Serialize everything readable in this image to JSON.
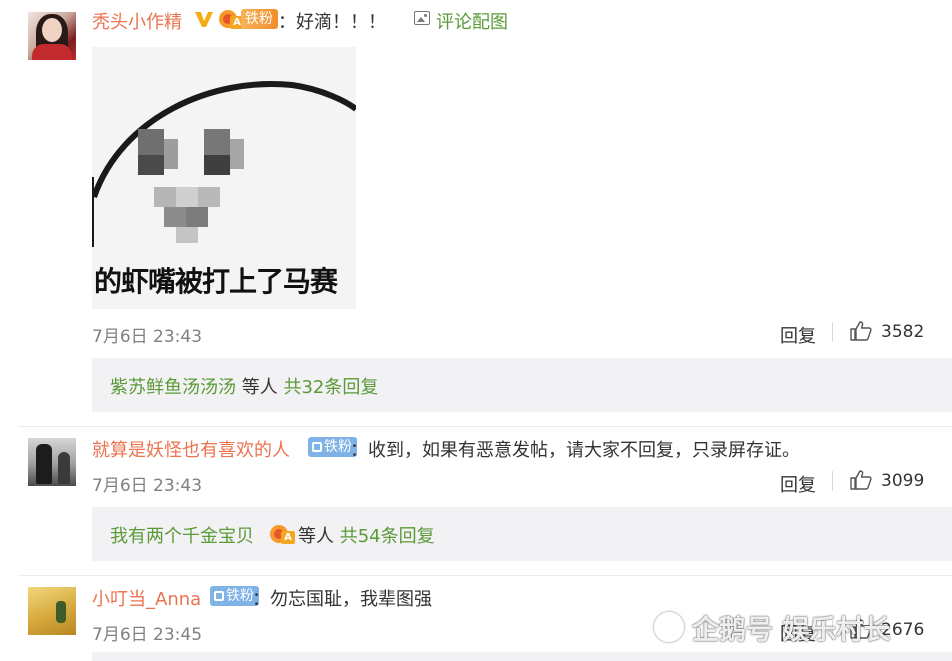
{
  "comments": [
    {
      "user": "秃头小作精",
      "fan_badge": "铁粉",
      "text": "：好滴！！！",
      "image_link": "评论配图",
      "image_caption": "的虾嘴被打上了马赛",
      "time": "7月6日 23:43",
      "reply_label": "回复",
      "likes": "3582",
      "thread": {
        "users": "紫苏鲜鱼汤汤汤",
        "mid": " 等人 ",
        "count": "共32条回复"
      }
    },
    {
      "user": "就算是妖怪也有喜欢的人",
      "fan_badge": "铁粉",
      "text": "：收到，如果有恶意发帖，请大家不回复，只录屏存证。",
      "time": "7月6日 23:43",
      "reply_label": "回复",
      "likes": "3099",
      "thread": {
        "users": "我有两个千金宝贝",
        "mid": " 等人 ",
        "count": "共54条回复"
      }
    },
    {
      "user": "小叮当_Anna",
      "fan_badge": "铁粉",
      "text": "：勿忘国耻，我辈图强",
      "time": "7月6日 23:45",
      "reply_label": "回复",
      "likes": "2676"
    }
  ],
  "watermark": "企鹅号 娱乐村长",
  "colors": {
    "username": "#eb7350",
    "link": "#5b9a37",
    "meta": "#808080",
    "reply_bg": "#f2f2f5"
  },
  "icons": [
    "verified-v-icon",
    "crown-fan-icon",
    "image-icon",
    "thumb-up-icon"
  ]
}
